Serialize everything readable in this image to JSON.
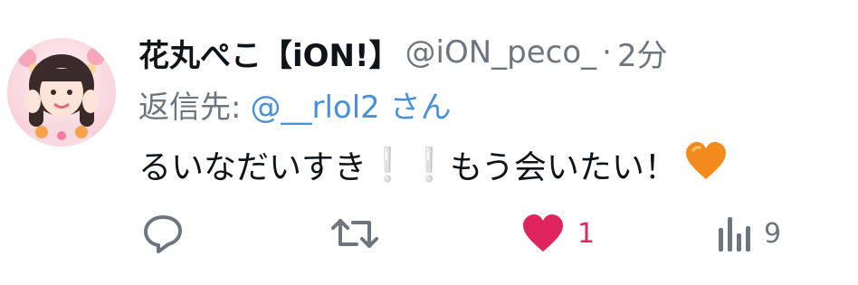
{
  "tweet": {
    "display_name": "花丸ぺこ【iON!】",
    "handle": "@iON_peco_",
    "separator": "·",
    "time": "2分",
    "reply_prefix": "返信先:",
    "reply_target": "@__rlol2 さん",
    "body_text": "るいなだいすき",
    "body_exclaim": "❕",
    "body_text_2": "もう会いたい！",
    "body_emoji": "orange-heart-icon"
  },
  "actions": {
    "reply": {
      "icon": "reply-icon",
      "count": ""
    },
    "retweet": {
      "icon": "retweet-icon",
      "count": ""
    },
    "like": {
      "icon": "heart-icon",
      "count": "1",
      "active": true
    },
    "views": {
      "icon": "views-icon",
      "count": "9"
    }
  },
  "colors": {
    "text": "#0f1419",
    "muted": "#6e767d",
    "link": "#4a90d9",
    "like": "#e0245e",
    "emoji_heart": "#f28b1c"
  }
}
